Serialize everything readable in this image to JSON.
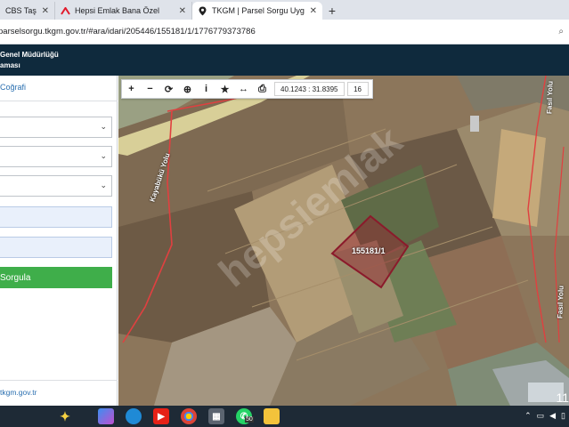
{
  "browser": {
    "tabs": [
      {
        "title": "CBS Taşınma",
        "icon": "globe-icon",
        "active": false
      },
      {
        "title": "Hepsi Emlak Bana Özel",
        "icon": "hepsiemlak-logo-icon",
        "active": false
      },
      {
        "title": "TKGM | Parsel Sorgu Uygulama",
        "icon": "location-pin-icon",
        "active": true
      }
    ],
    "new_tab_label": "+",
    "url": "parselsorgu.tkgm.gov.tr/#ara/idari/205446/155181/1/1776779373786"
  },
  "header": {
    "line1": "Genel Müdürlüğü",
    "line2": "aması"
  },
  "left_panel": {
    "tab_label": "Coğrafi",
    "submit_label": "Sorgula",
    "footer_link": "tkgm.gov.tr"
  },
  "map": {
    "coordinates": "40.1243 : 31.8395",
    "zoom_level": "16",
    "parcel_label": "155181/1",
    "road_labels": [
      "Kayabükü Yolu",
      "Fasıl Yolu",
      "Fasıl Yolu"
    ],
    "watermark": "hepsiemlak",
    "clock_fragment": "11"
  },
  "toolbar_tools": [
    "plus-icon",
    "minus-icon",
    "refresh-icon",
    "locate-icon",
    "info-icon",
    "star-icon",
    "measure-icon",
    "print-icon"
  ],
  "taskbar": {
    "whatsapp_badge": "50"
  },
  "colors": {
    "header_bg": "#0f2a3d",
    "button_green": "#3fae4a",
    "parcel_outline": "#8b1a2b",
    "link_blue": "#2a6fb0"
  }
}
